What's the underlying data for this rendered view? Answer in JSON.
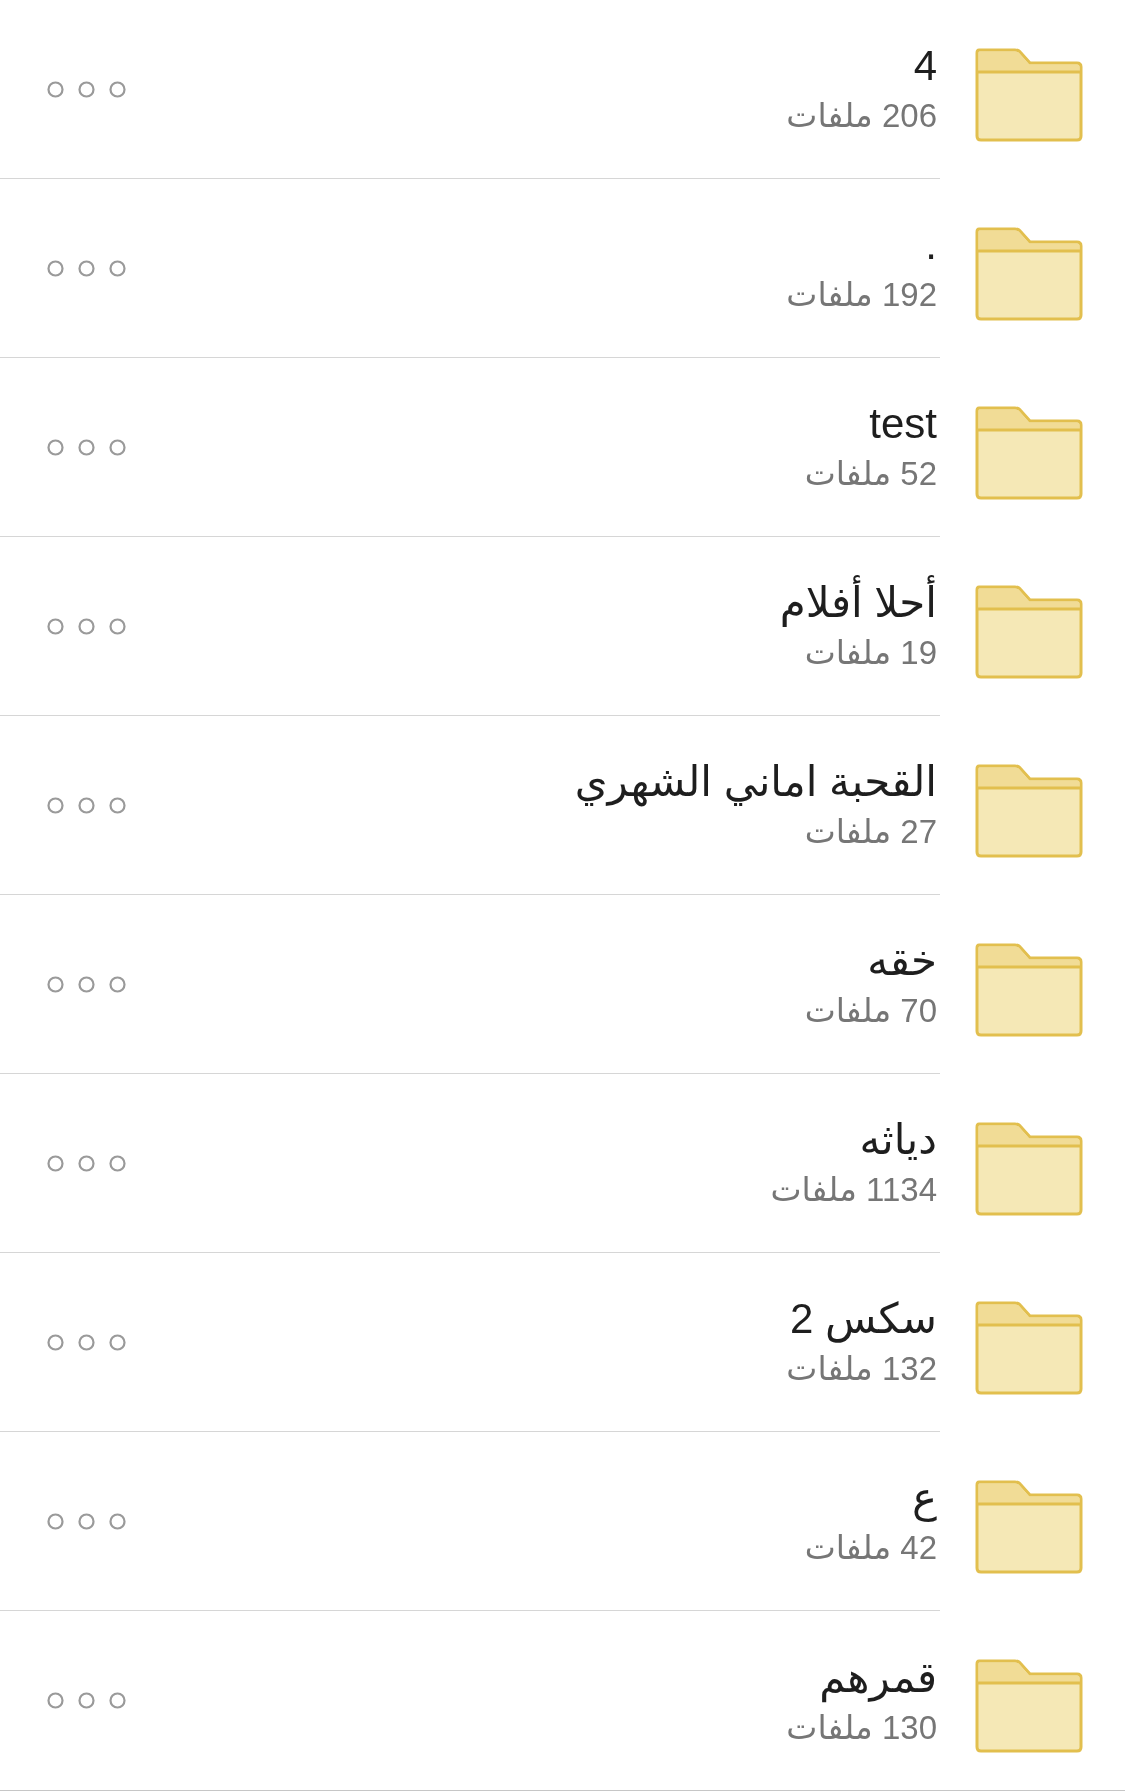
{
  "folders": [
    {
      "name": "4",
      "file_count": "206 ملفات"
    },
    {
      "name": ".",
      "file_count": "192 ملفات"
    },
    {
      "name": "test",
      "file_count": "52 ملفات"
    },
    {
      "name": "أحلا أفلام",
      "file_count": "19 ملفات"
    },
    {
      "name": "القحبة اماني الشهري",
      "file_count": "27 ملفات"
    },
    {
      "name": "خقه",
      "file_count": "70 ملفات"
    },
    {
      "name": "دياثه",
      "file_count": "1134 ملفات"
    },
    {
      "name": "سكس 2",
      "file_count": "132 ملفات"
    },
    {
      "name": "ع",
      "file_count": "42 ملفات"
    },
    {
      "name": "قمرهم",
      "file_count": "130 ملفات"
    }
  ]
}
